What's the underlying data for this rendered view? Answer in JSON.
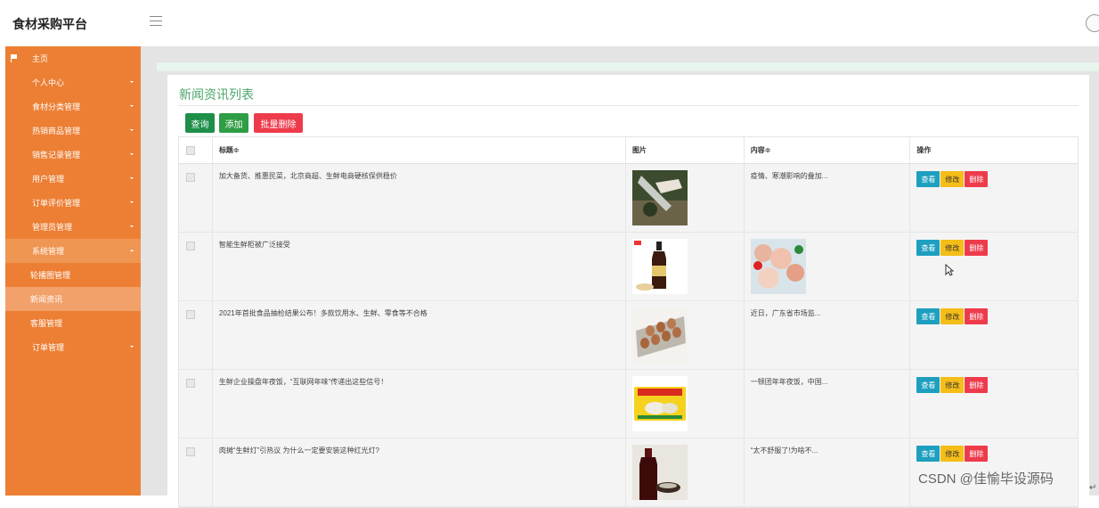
{
  "app": {
    "title": "食材采购平台"
  },
  "sidebar": {
    "items": [
      {
        "label": "主页",
        "icon": "flag-icon",
        "caret": false
      },
      {
        "label": "个人中心",
        "icon": "grid-icon",
        "caret": true
      },
      {
        "label": "食材分类管理",
        "icon": "grid-icon",
        "caret": true
      },
      {
        "label": "热销商品管理",
        "icon": "grid-icon",
        "caret": true
      },
      {
        "label": "销售记录管理",
        "icon": "grid-icon",
        "caret": true
      },
      {
        "label": "用户管理",
        "icon": "grid-icon",
        "caret": true
      },
      {
        "label": "订单评价管理",
        "icon": "grid-icon",
        "caret": true
      },
      {
        "label": "管理员管理",
        "icon": "grid-icon",
        "caret": true
      },
      {
        "label": "系统管理",
        "icon": "grid-icon",
        "caret": true,
        "expanded": true
      },
      {
        "label": "订单管理",
        "icon": "grid-icon",
        "caret": true
      }
    ],
    "subitems": [
      {
        "label": "轮播图管理"
      },
      {
        "label": "新闻资讯",
        "selected": true
      },
      {
        "label": "客服管理"
      }
    ]
  },
  "panel": {
    "title": "新闻资讯列表",
    "buttons": {
      "search": "查询",
      "add": "添加",
      "batch_delete": "批量删除"
    }
  },
  "table": {
    "headers": {
      "title": "标题≑",
      "image": "图片",
      "content": "内容≑",
      "actions": "操作"
    },
    "action_labels": {
      "view": "查看",
      "edit": "修改",
      "delete": "删除"
    },
    "rows": [
      {
        "title": "加大备货、推惠民菜，北京商超、生鲜电商硬核保供稳价",
        "image": "fish-photo",
        "content": "疫情、寒潮影响的叠加..."
      },
      {
        "title": "智能生鲜柜被广泛接受",
        "image": "soy-sauce-bottle-photo",
        "content_image": "seafood-platter-photo",
        "content": ""
      },
      {
        "title": "2021年首批食品抽检结果公布！多款饮用水、生鲜、零食等不合格",
        "image": "egg-tray-photo",
        "content": "  近日，广东省市场监..."
      },
      {
        "title": "生鲜企业操盘年夜饭，“互联网年味”传递出这些信号！",
        "image": "dumpling-package-photo",
        "content": "一顿团年年夜饭，中国..."
      },
      {
        "title": "肉摊“生鲜灯”引热议 为什么一定要安装这种红光灯?",
        "image": "sauce-bottle-photo",
        "content": " “太不舒服了!为啥不..."
      }
    ]
  },
  "watermark": "CSDN @佳愉毕设源码",
  "return_glyph": "↵"
}
